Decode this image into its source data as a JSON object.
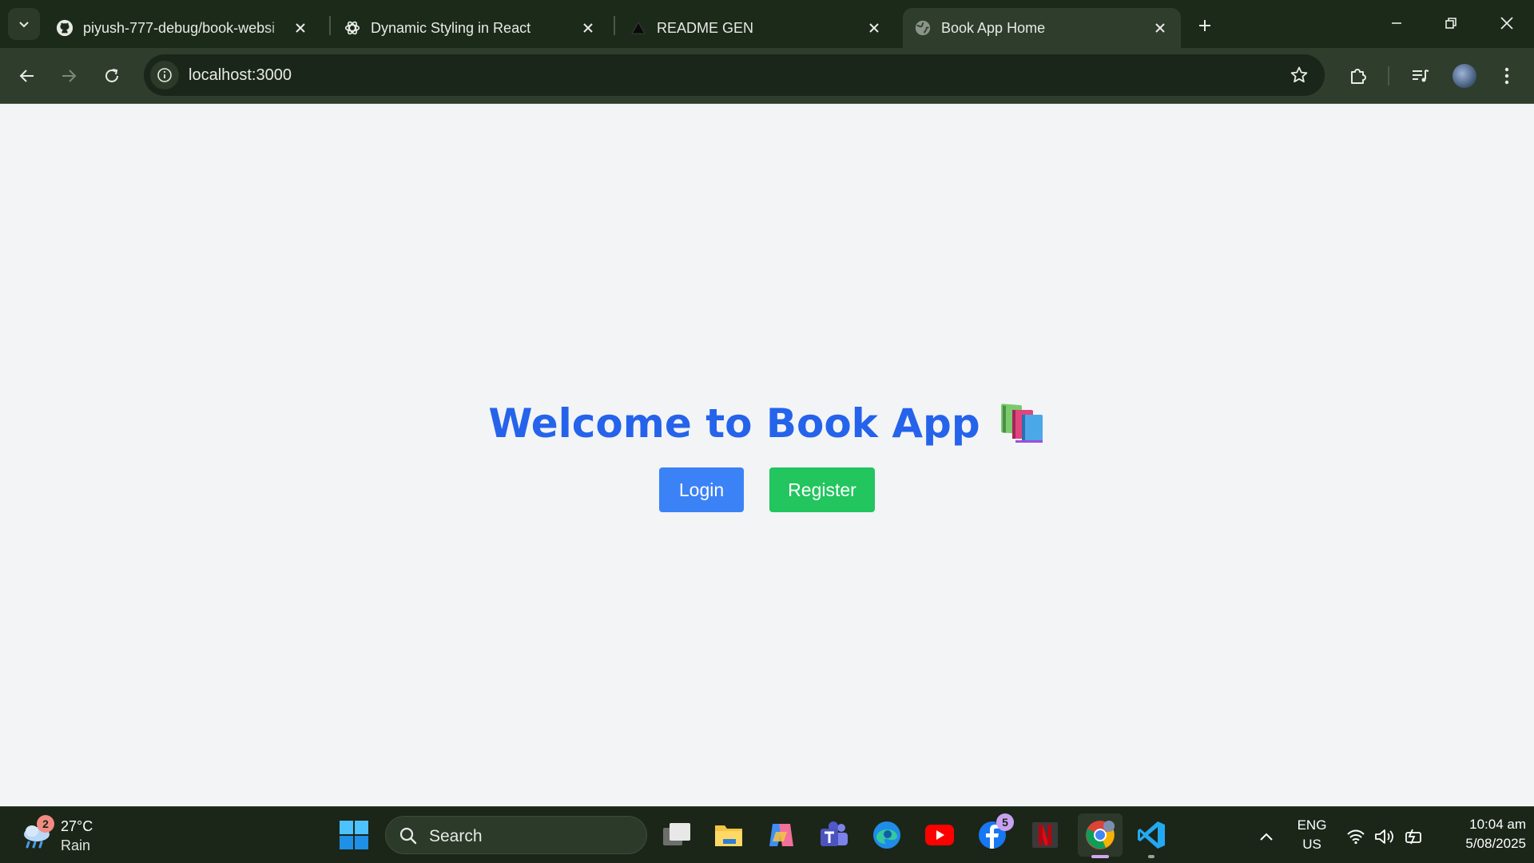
{
  "browser": {
    "tabs": [
      {
        "title": "piyush-777-debug/book-websi",
        "icon": "github-icon"
      },
      {
        "title": "Dynamic Styling in React",
        "icon": "chatgpt-icon"
      },
      {
        "title": "README GEN",
        "icon": "triangle-icon"
      },
      {
        "title": "Book App Home",
        "icon": "globe-icon",
        "active": true
      }
    ],
    "url": "localhost:3000"
  },
  "page": {
    "heading": "Welcome to Book App",
    "login_label": "Login",
    "register_label": "Register",
    "colors": {
      "heading": "#2563eb",
      "login": "#3b82f6",
      "register": "#22c55e"
    }
  },
  "taskbar": {
    "weather": {
      "temp": "27°C",
      "condition": "Rain",
      "badge": "2"
    },
    "search_placeholder": "Search",
    "facebook_badge": "5",
    "language": {
      "line1": "ENG",
      "line2": "US"
    },
    "clock": {
      "time": "10:04 am",
      "date": "5/08/2025"
    }
  }
}
